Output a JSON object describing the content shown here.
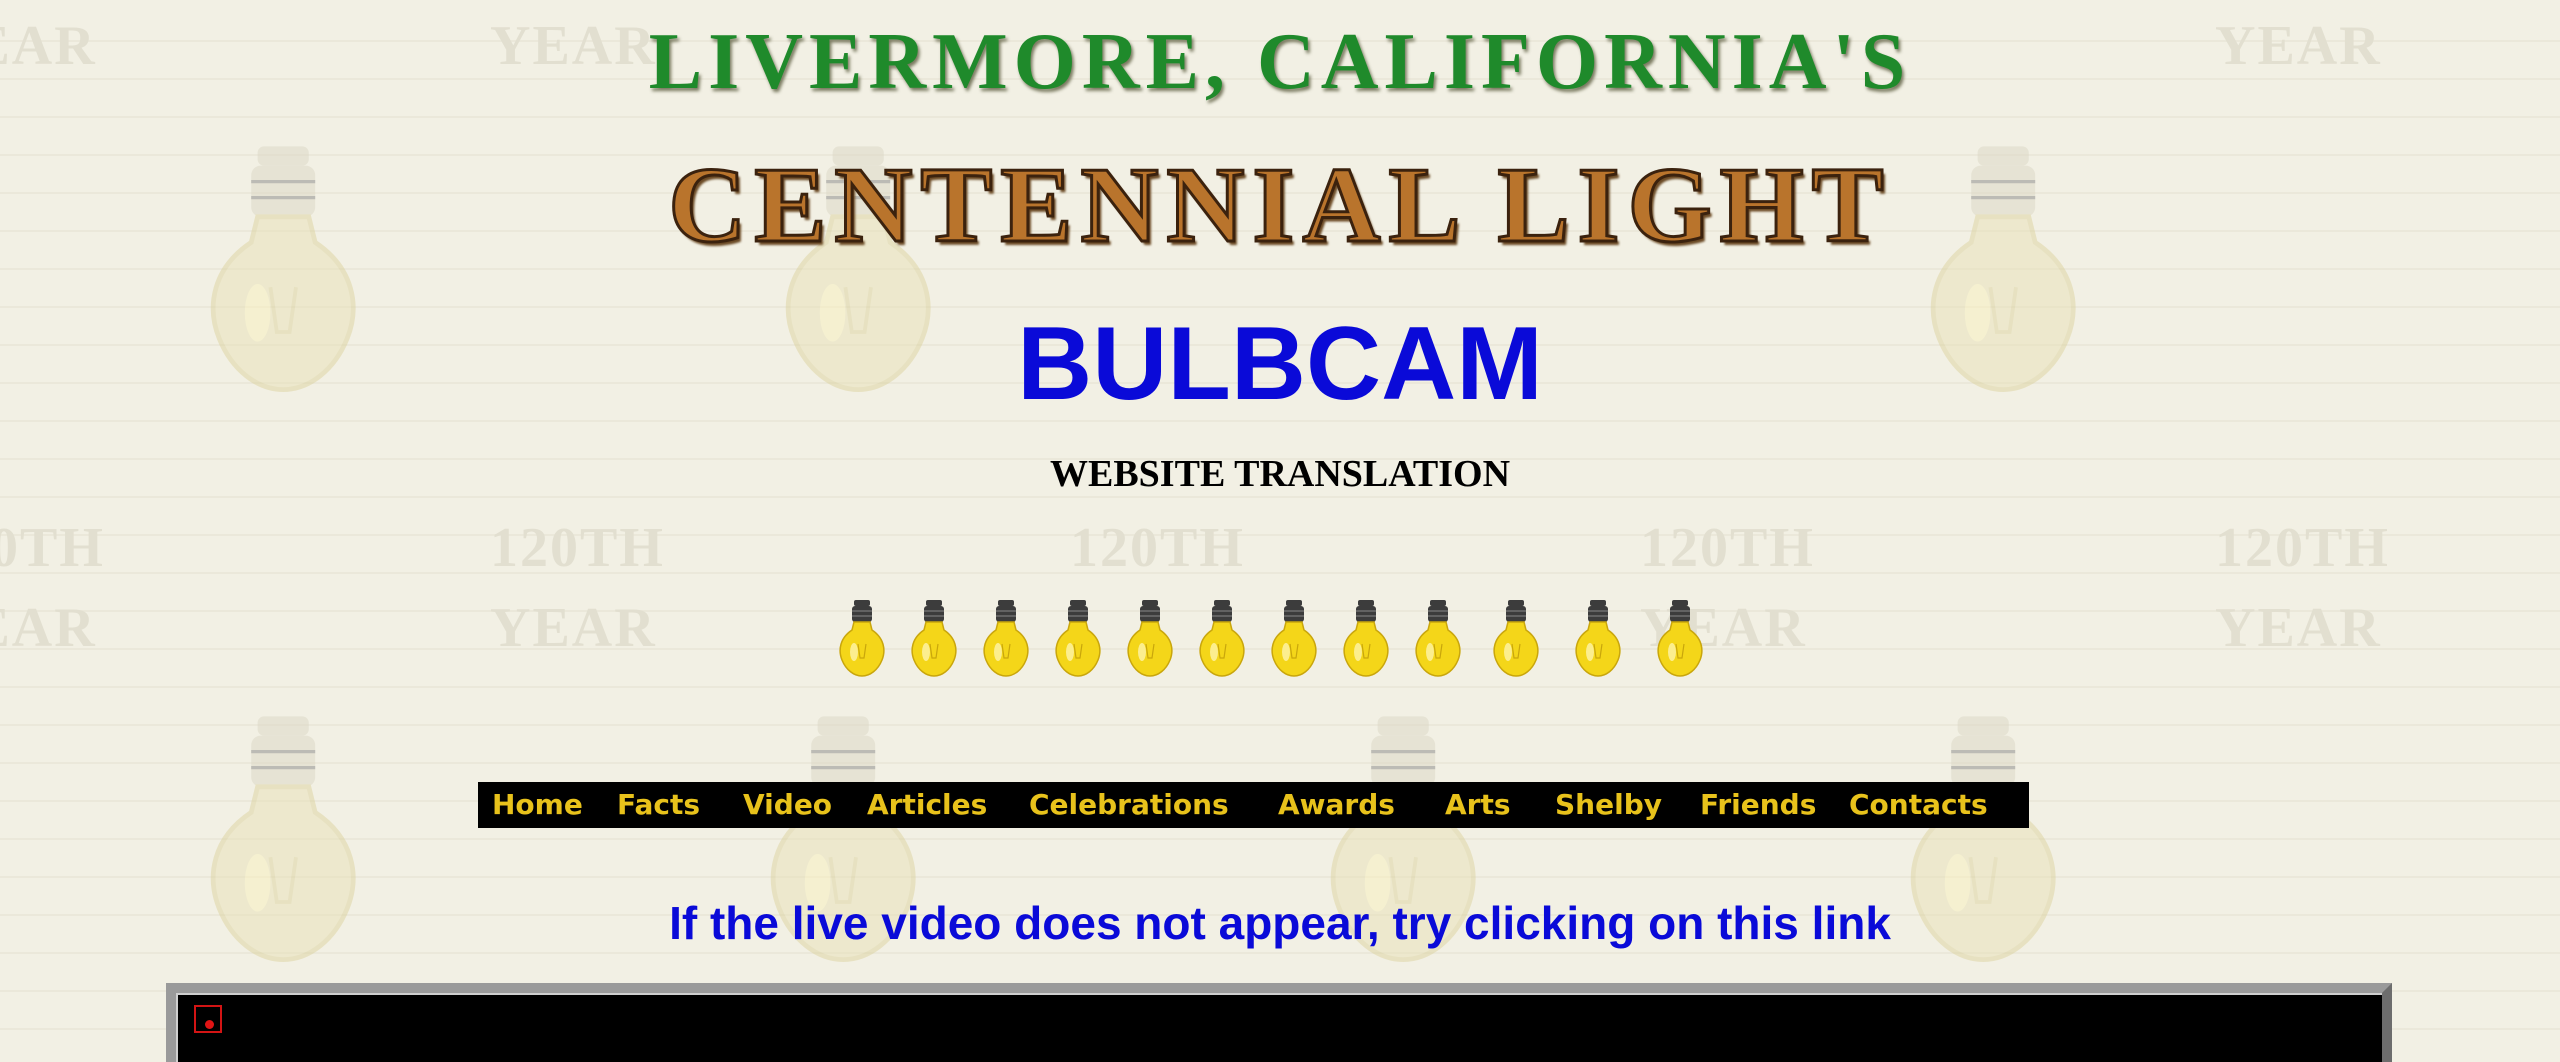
{
  "header": {
    "subtitle": "LIVERMORE, CALIFORNIA'S",
    "title": "CENTENNIAL LIGHT",
    "page_title": "BULBCAM",
    "translation_label": "WEBSITE TRANSLATION"
  },
  "background": {
    "watermark_texts": [
      "YEAR",
      "120TH"
    ],
    "colors": {
      "page": "#f2f0e4",
      "pattern": "#e2dfd0"
    }
  },
  "bulb_row": {
    "count": 12,
    "icon": "light-bulb-icon"
  },
  "nav": {
    "items": [
      {
        "label": "Home"
      },
      {
        "label": "Facts"
      },
      {
        "label": "Video"
      },
      {
        "label": "Articles"
      },
      {
        "label": "Celebrations"
      },
      {
        "label": "Awards"
      },
      {
        "label": "Arts"
      },
      {
        "label": "Shelby"
      },
      {
        "label": "Friends"
      },
      {
        "label": "Contacts"
      }
    ],
    "colors": {
      "background": "#000000",
      "text": "#e8c21b"
    }
  },
  "video": {
    "link_text": "If the live video does not appear, try clicking on this link",
    "record_icon": "record-indicator-icon"
  },
  "colors": {
    "green_title": "#1f8a2b",
    "blue_text": "#0a0ad8",
    "bronze_title": "#b9742c"
  }
}
